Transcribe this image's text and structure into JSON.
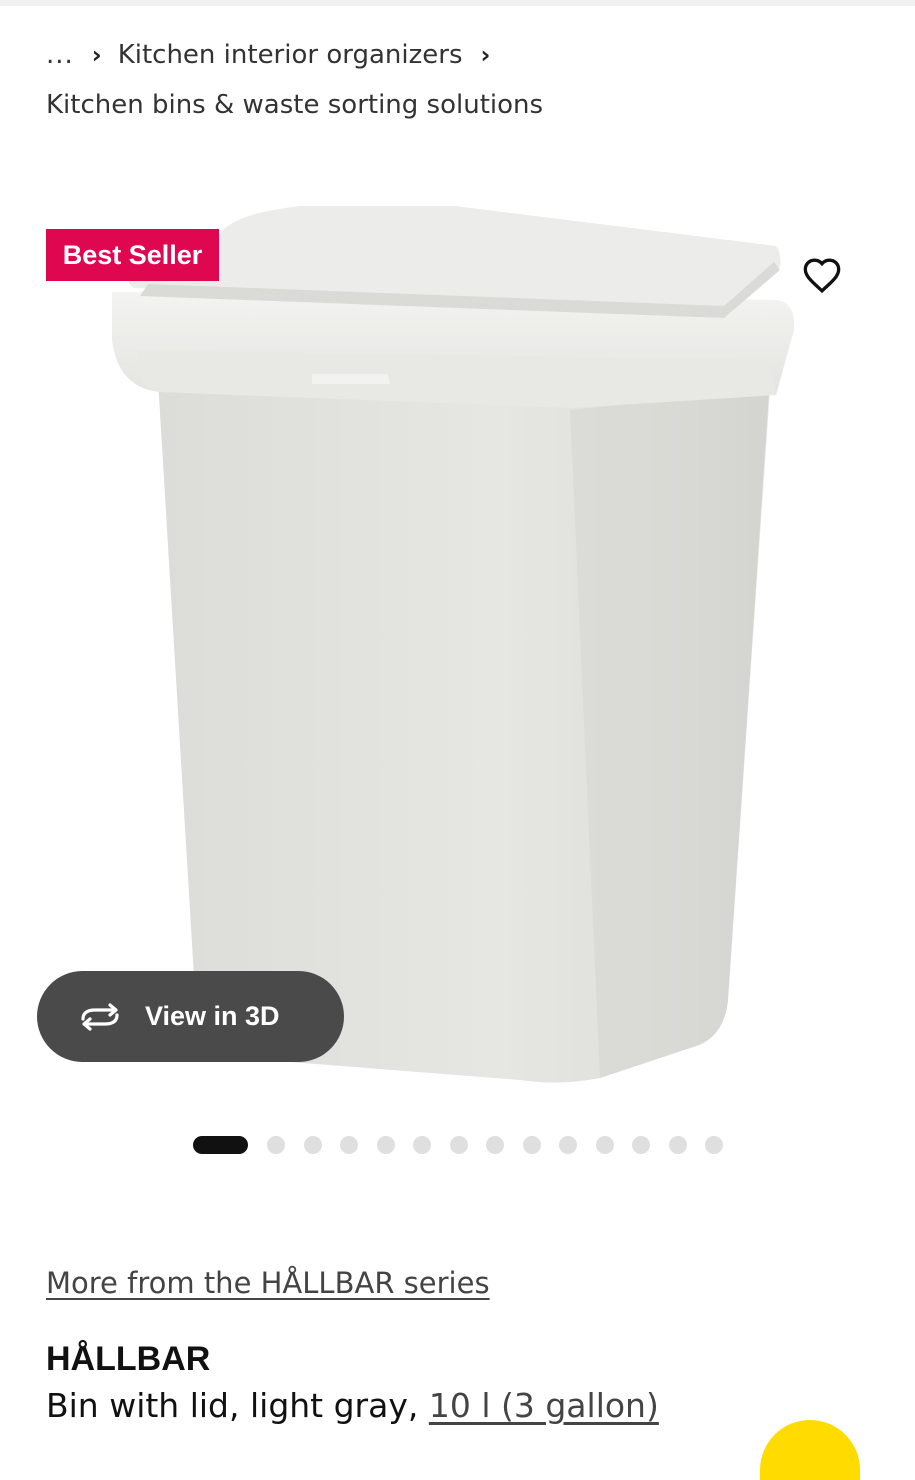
{
  "breadcrumb": {
    "ellipsis": "...",
    "item_1": "Kitchen interior organizers",
    "item_2": "Kitchen bins & waste sorting solutions"
  },
  "badge": {
    "label": "Best Seller",
    "color": "#e00751"
  },
  "favorite": {
    "icon": "heart-icon"
  },
  "view_3d": {
    "label": "View in 3D",
    "icon": "rotate-3d-icon"
  },
  "carousel": {
    "total_images": 15,
    "active_index": 0
  },
  "series_link": "More from the HÅLLBAR series",
  "product": {
    "name": "HÅLLBAR",
    "description": "Bin with lid, light gray, ",
    "size_label": "10 l (3 gallon)"
  },
  "colors": {
    "accent_yellow": "#ffdb00",
    "pill_bg": "#4a4a4a"
  }
}
